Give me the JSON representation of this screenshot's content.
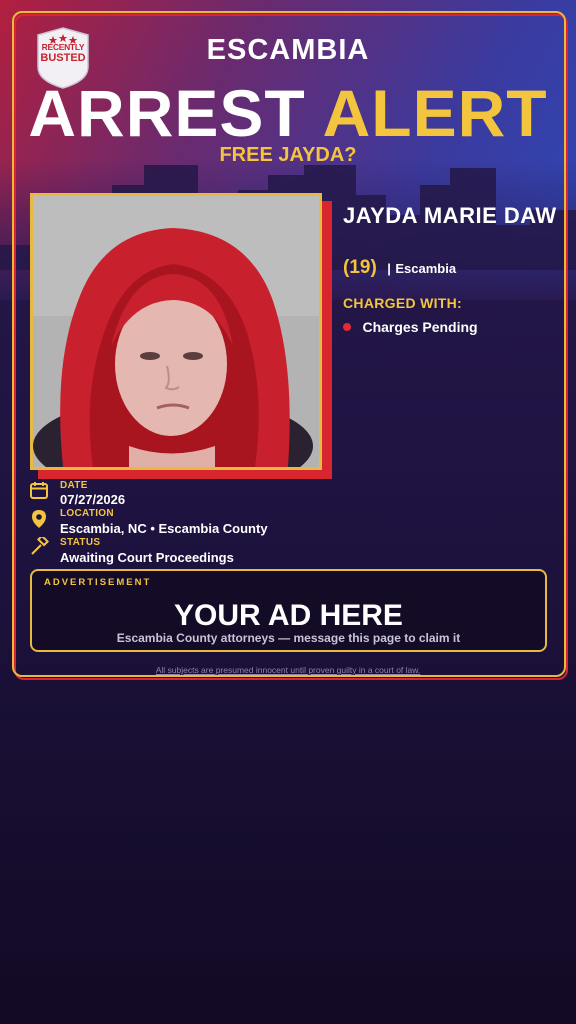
{
  "badge": {
    "line1": "RECENTLY",
    "line2": "BUSTED",
    "icon": "star-shield-icon"
  },
  "header": {
    "county": "ESCAMBIA",
    "headline_word1": "ARREST",
    "headline_word2": "ALERT",
    "subhead": "FREE JAYDA?"
  },
  "subject": {
    "name": "JAYDA MARIE DAW",
    "age": "(19)",
    "separator": "|",
    "city": "Escambia",
    "photo_icon": "mugshot-photo"
  },
  "charges": {
    "label": "CHARGED WITH:",
    "items": [
      "Charges Pending"
    ]
  },
  "details": {
    "date_label": "DATE",
    "date_value": "07/27/2026",
    "location_label": "LOCATION",
    "location_value": "Escambia, NC • Escambia County",
    "status_label": "STATUS",
    "status_value": "Awaiting Court Proceedings"
  },
  "ad": {
    "label": "ADVERTISEMENT",
    "title": "YOUR AD HERE",
    "subtitle": "Escambia County attorneys — message this page to claim it"
  },
  "footer": {
    "disclaimer": "All subjects are presumed innocent until proven guilty in a court of law."
  },
  "colors": {
    "accent_gold": "#f3c53e",
    "accent_red": "#d8262f",
    "background": "#1e1340"
  }
}
